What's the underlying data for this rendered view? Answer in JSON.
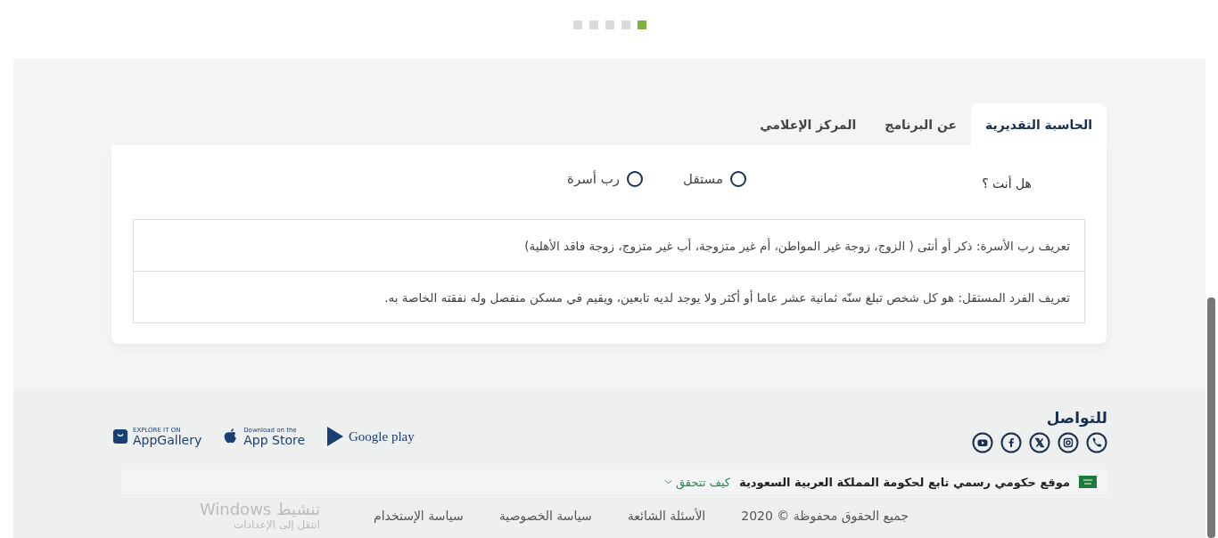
{
  "carousel_dots": [
    {
      "selected": false
    },
    {
      "selected": false
    },
    {
      "selected": false
    },
    {
      "selected": false
    },
    {
      "selected": true
    }
  ],
  "tabs": [
    {
      "label": "الحاسبة التقديرية",
      "selected": true
    },
    {
      "label": "عن البرنامج",
      "selected": false
    },
    {
      "label": "المركز الإعلامي",
      "selected": false
    }
  ],
  "question": {
    "label": "هل أنت ؟",
    "options": [
      {
        "label": "مستقل",
        "selected": false
      },
      {
        "label": "رب أسرة",
        "selected": false
      }
    ]
  },
  "definitions": [
    "تعريف رب الأسرة: ذكر أو أنثى ( الزوج، زوجة غير المواطن، أم غير متزوجة، أب غير متزوج، زوجة فاقد الأهلية)",
    "تعريف الفرد المستقل: هو كل شخص تبلغ سنّه ثمانية عشر عاما أو أكثر ولا يوجد لديه تابعين، ويقيم في مسكن منفصل وله نفقته الخاصة به."
  ],
  "footer": {
    "contact_title": "للتواصل",
    "social": [
      {
        "kind": "phone"
      },
      {
        "kind": "instagram"
      },
      {
        "kind": "x"
      },
      {
        "kind": "facebook"
      },
      {
        "kind": "youtube"
      }
    ],
    "app_badges": [
      {
        "kind": "google_play",
        "big": "Google play"
      },
      {
        "kind": "app_store",
        "small": "Download on the",
        "big": "App Store"
      },
      {
        "kind": "app_gallery",
        "small": "EXPLORE IT ON",
        "big": "AppGallery"
      }
    ],
    "gov_notice": {
      "text": "موقع حكومي رسمي تابع لحكومة المملكة العربية السعودية",
      "link": "كيف تتحقق"
    },
    "copyright": "جميع الحقوق محفوظة © 2020",
    "links": [
      "الأسئلة الشائعة",
      "سياسة الخصوصية",
      "سياسة الإستخدام"
    ],
    "windows_notice": {
      "title": "تنشيط Windows",
      "subtitle": "انتقل إلى الإعدادات"
    }
  }
}
